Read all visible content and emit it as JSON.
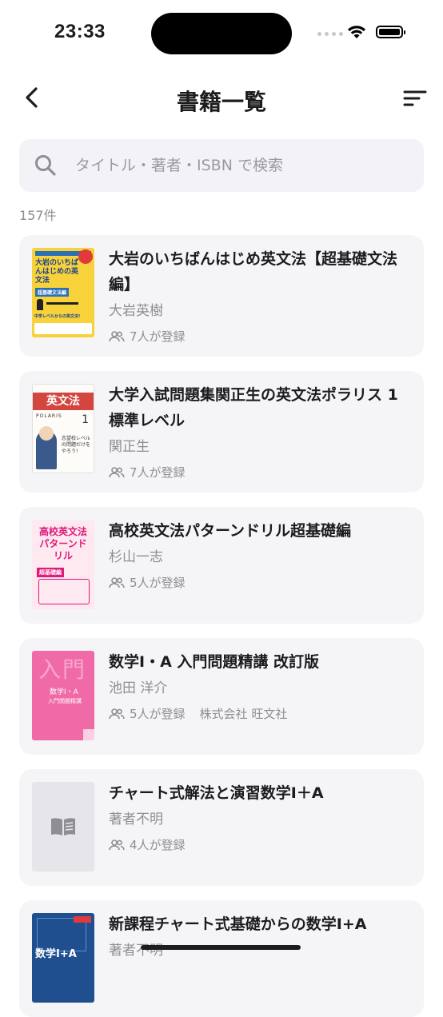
{
  "status": {
    "time": "23:33"
  },
  "nav": {
    "title": "書籍一覧"
  },
  "search": {
    "placeholder": "タイトル・著者・ISBN で検索",
    "value": ""
  },
  "count": "157件",
  "books": [
    {
      "title": "大岩のいちばんはじめ英文法【超基礎文法編】",
      "author": "大岩英樹",
      "registered": "7人が登録",
      "publisher": "",
      "cover": {
        "heading": "大岩のいちばんはじめの英文法",
        "sub": "超基礎文法編",
        "tag": "中学レベルからの英文法!"
      }
    },
    {
      "title": "大学入試問題集関正生の英文法ポラリス 1 標準レベル",
      "author": "関正生",
      "registered": "7人が登録",
      "publisher": "",
      "cover": {
        "heading": "英文法",
        "sub": "POLARIS",
        "num": "1",
        "tag": "志望校レベルの問題だけをやろう!"
      }
    },
    {
      "title": "高校英文法パターンドリル超基礎編",
      "author": "杉山一志",
      "registered": "5人が登録",
      "publisher": "",
      "cover": {
        "heading": "高校英文法パターンドリル",
        "sub": "超基礎編"
      }
    },
    {
      "title": "数学Ⅰ・A 入門問題精講 改訂版",
      "author": "池田 洋介",
      "registered": "5人が登録",
      "publisher": "株式会社 旺文社",
      "cover": {
        "heading": "入門",
        "sub": "数学Ⅰ・A",
        "tag": "入門問題精講"
      }
    },
    {
      "title": "チャート式解法と演習数学I＋A",
      "author": "著者不明",
      "registered": "4人が登録",
      "publisher": "",
      "cover": {
        "icon": "book-icon"
      }
    },
    {
      "title": "新課程チャート式基礎からの数学I+A",
      "author": "著者不明",
      "registered": "",
      "publisher": "",
      "cover": {
        "heading": "数学Ⅰ+A"
      }
    }
  ],
  "colors": {
    "accent": "#1c1c1e",
    "card": "#f5f5f7",
    "muted": "#8e8e93"
  }
}
